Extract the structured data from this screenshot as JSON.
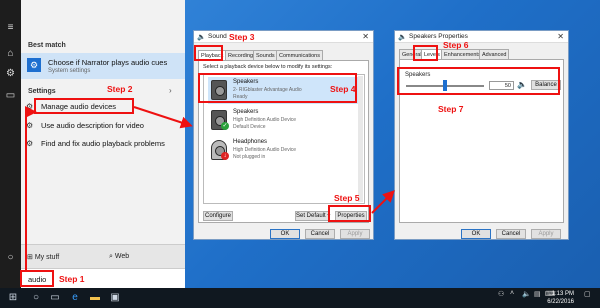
{
  "colors": {
    "annotation": "#e11111",
    "accent": "#1d6fd0",
    "selection": "#cfe3f7"
  },
  "start_menu": {
    "best_match_header": "Best match",
    "best_match": {
      "title": "Choose if Narrator plays audio cues",
      "subtitle": "System settings",
      "icon": "gear-icon"
    },
    "settings_header": "Settings",
    "items": [
      {
        "label": "Manage audio devices",
        "icon": "gear-icon"
      },
      {
        "label": "Use audio description for video",
        "icon": "gear-icon"
      },
      {
        "label": "Find and fix audio playback problems",
        "icon": "gear-icon"
      }
    ],
    "my_stuff": "My stuff",
    "web": "Web",
    "search_value": "audio"
  },
  "steps": {
    "s1": "Step 1",
    "s2": "Step 2",
    "s3": "Step 3",
    "s4": "Step 4",
    "s5": "Step 5",
    "s6": "Step 6",
    "s7": "Step 7"
  },
  "sound_dialog": {
    "title": "Sound",
    "tabs": [
      "Playback",
      "Recording",
      "Sounds",
      "Communications"
    ],
    "instruction": "Select a playback device below to modify its settings:",
    "devices": [
      {
        "name": "Speakers",
        "line2": "2- RIGblaster Advantage Audio",
        "line3": "Ready"
      },
      {
        "name": "Speakers",
        "line2": "High Definition Audio Device",
        "line3": "Default Device"
      },
      {
        "name": "Headphones",
        "line2": "High Definition Audio Device",
        "line3": "Not plugged in"
      }
    ],
    "configure": "Configure",
    "set_default": "Set Default",
    "properties": "Properties",
    "ok": "OK",
    "cancel": "Cancel",
    "apply": "Apply"
  },
  "speakers_dialog": {
    "title": "Speakers Properties",
    "tabs": [
      "General",
      "Levels",
      "Enhancements",
      "Advanced"
    ],
    "level_label": "Speakers",
    "level_value": "50",
    "balance": "Balance",
    "ok": "OK",
    "cancel": "Cancel",
    "apply": "Apply"
  },
  "taskbar": {
    "time": "1:13 PM",
    "date": "6/22/2016"
  }
}
